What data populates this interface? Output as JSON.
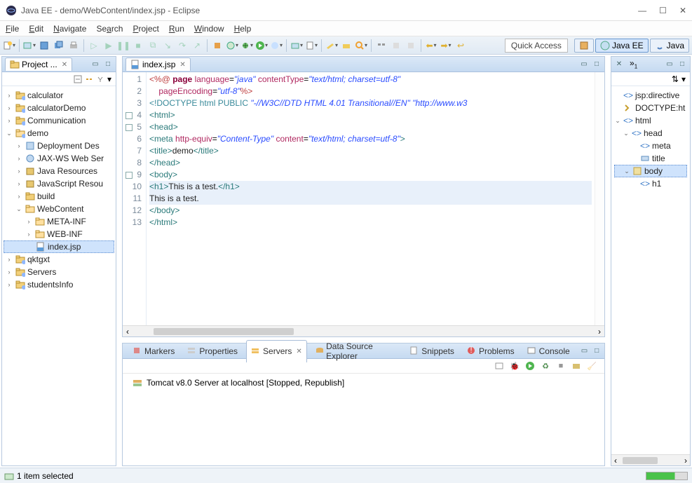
{
  "window": {
    "title": "Java EE - demo/WebContent/index.jsp - Eclipse"
  },
  "menu": {
    "file": "File",
    "edit": "Edit",
    "navigate": "Navigate",
    "search": "Search",
    "project": "Project",
    "run": "Run",
    "window": "Window",
    "help": "Help"
  },
  "toolbar": {
    "quick_access": "Quick Access"
  },
  "perspectives": {
    "java_ee": "Java EE",
    "java": "Java"
  },
  "project_explorer": {
    "title": "Project ...",
    "items": [
      {
        "label": "calculator",
        "indent": 0,
        "tw": "›",
        "icon": "project"
      },
      {
        "label": "calculatorDemo",
        "indent": 0,
        "tw": "›",
        "icon": "project"
      },
      {
        "label": "Communication",
        "indent": 0,
        "tw": "›",
        "icon": "project"
      },
      {
        "label": "demo",
        "indent": 0,
        "tw": "⌄",
        "icon": "project-open"
      },
      {
        "label": "Deployment Des",
        "indent": 1,
        "tw": "›",
        "icon": "dd"
      },
      {
        "label": "JAX-WS Web Ser",
        "indent": 1,
        "tw": "›",
        "icon": "ws"
      },
      {
        "label": "Java Resources",
        "indent": 1,
        "tw": "›",
        "icon": "jar"
      },
      {
        "label": "JavaScript Resou",
        "indent": 1,
        "tw": "›",
        "icon": "js"
      },
      {
        "label": "build",
        "indent": 1,
        "tw": "›",
        "icon": "folder"
      },
      {
        "label": "WebContent",
        "indent": 1,
        "tw": "⌄",
        "icon": "folder-open"
      },
      {
        "label": "META-INF",
        "indent": 2,
        "tw": "›",
        "icon": "folder-open"
      },
      {
        "label": "WEB-INF",
        "indent": 2,
        "tw": "›",
        "icon": "folder-open"
      },
      {
        "label": "index.jsp",
        "indent": 2,
        "tw": "",
        "icon": "jsp",
        "selected": true
      },
      {
        "label": "qktgxt",
        "indent": 0,
        "tw": "›",
        "icon": "project"
      },
      {
        "label": "Servers",
        "indent": 0,
        "tw": "›",
        "icon": "project"
      },
      {
        "label": "studentsInfo",
        "indent": 0,
        "tw": "›",
        "icon": "project"
      }
    ]
  },
  "editor": {
    "tab": "index.jsp",
    "lines": [
      {
        "n": "1",
        "html": "<span class='tok-dir'>&lt;%@</span> <span class='tok-kw'>page</span> <span class='tok-attr'>language</span>=<span class='tok-str'>\"java\"</span> <span class='tok-attr'>contentType</span>=<span class='tok-str'>\"text/html; charset=utf-8\"</span>"
      },
      {
        "n": "2",
        "html": "    <span class='tok-attr'>pageEncoding</span>=<span class='tok-str'>\"utf-8\"</span><span class='tok-dir'>%&gt;</span>"
      },
      {
        "n": "3",
        "html": "<span class='tok-doc'>&lt;!DOCTYPE html PUBLIC </span><span class='tok-str'>\"-//W3C//DTD HTML 4.01 Transitional//EN\"</span> <span class='tok-str'>\"http://www.w3</span>"
      },
      {
        "n": "4",
        "m": true,
        "html": "<span class='tok-tag'>&lt;html&gt;</span>"
      },
      {
        "n": "5",
        "m": true,
        "html": "<span class='tok-tag'>&lt;head&gt;</span>"
      },
      {
        "n": "6",
        "html": "<span class='tok-tag'>&lt;meta</span> <span class='tok-attr'>http-equiv</span>=<span class='tok-str'>\"Content-Type\"</span> <span class='tok-attr'>content</span>=<span class='tok-str'>\"text/html; charset=utf-8\"</span><span class='tok-tag'>&gt;</span>"
      },
      {
        "n": "7",
        "html": "<span class='tok-tag'>&lt;title&gt;</span><span class='tok-txt'>demo</span><span class='tok-tag'>&lt;/title&gt;</span>"
      },
      {
        "n": "8",
        "html": "<span class='tok-tag'>&lt;/head&gt;</span>"
      },
      {
        "n": "9",
        "m": true,
        "html": "<span class='tok-tag'>&lt;body&gt;</span>"
      },
      {
        "n": "10",
        "hl": true,
        "html": "<span class='tok-tag'>&lt;h1&gt;</span><span class='tok-txt'>This is a test.</span><span class='tok-tag'>&lt;/h1&gt;</span>"
      },
      {
        "n": "11",
        "hl": true,
        "html": "<span class='tok-txt'>This is a test.</span>"
      },
      {
        "n": "12",
        "html": "<span class='tok-tag'>&lt;/body&gt;</span>"
      },
      {
        "n": "13",
        "html": "<span class='tok-tag'>&lt;/html&gt;</span>"
      }
    ]
  },
  "outline": {
    "items": [
      {
        "label": "jsp:directive",
        "indent": 0,
        "tw": "",
        "icon": "tag-blue"
      },
      {
        "label": "DOCTYPE:ht",
        "indent": 0,
        "tw": "",
        "icon": "doctype"
      },
      {
        "label": "html",
        "indent": 0,
        "tw": "⌄",
        "icon": "tag"
      },
      {
        "label": "head",
        "indent": 1,
        "tw": "⌄",
        "icon": "tag"
      },
      {
        "label": "meta",
        "indent": 2,
        "tw": "",
        "icon": "tag"
      },
      {
        "label": "title",
        "indent": 2,
        "tw": "",
        "icon": "title"
      },
      {
        "label": "body",
        "indent": 1,
        "tw": "⌄",
        "icon": "body",
        "selected": true
      },
      {
        "label": "h1",
        "indent": 2,
        "tw": "",
        "icon": "tag"
      }
    ]
  },
  "bottom": {
    "tabs": {
      "markers": "Markers",
      "properties": "Properties",
      "servers": "Servers",
      "dse": "Data Source Explorer",
      "snippets": "Snippets",
      "problems": "Problems",
      "console": "Console"
    },
    "server": "Tomcat v8.0 Server at localhost  [Stopped, Republish]"
  },
  "status": {
    "text": "1 item selected"
  }
}
